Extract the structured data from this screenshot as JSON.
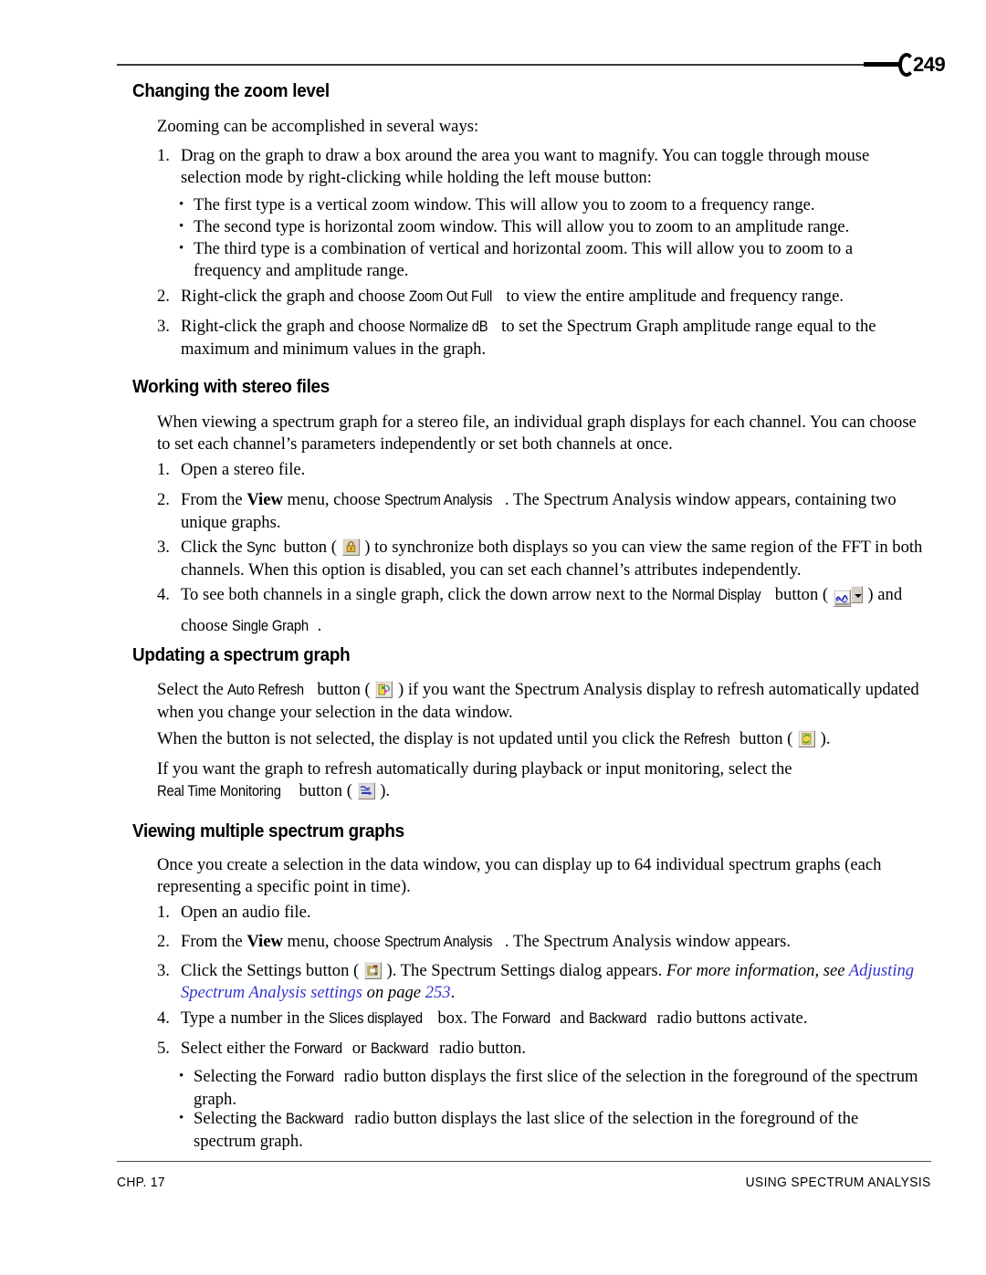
{
  "header": {
    "page_number": "249"
  },
  "footer": {
    "left": "CHP. 17",
    "right": "USING SPECTRUM ANALYSIS"
  },
  "sections": {
    "zoom_level": {
      "heading": "Changing the zoom level",
      "intro": "Zooming can be accomplished in several ways:",
      "item1": {
        "marker": "1.",
        "text": "Drag on the graph to draw a box around the area you want to magnify. You can toggle through mouse selection mode by right-clicking while holding the left mouse button:"
      },
      "bullets": [
        {
          "marker": "•",
          "text": "The first type is a vertical zoom window. This will allow you to zoom to a frequency range."
        },
        {
          "marker": "•",
          "text": "The second type is horizontal zoom window. This will allow you to zoom to an amplitude range."
        },
        {
          "marker": "•",
          "text": "The third type is a combination of vertical and horizontal zoom. This will allow you to zoom to a frequency and amplitude range."
        }
      ],
      "item2": {
        "marker": "2.",
        "pre": "Right-click the graph and choose ",
        "ui": "Zoom Out Full",
        "post": " to view the entire amplitude and frequency range."
      },
      "item3": {
        "marker": "3.",
        "pre": "Right-click the graph and choose ",
        "ui": "Normalize dB",
        "post": " to set the Spectrum Graph amplitude range equal to the maximum and minimum values in the graph."
      }
    },
    "stereo_files": {
      "heading": "Working with stereo files",
      "intro": "When viewing a spectrum graph for a stereo file, an individual graph displays for each channel. You can choose to set each channel’s parameters independently or set both channels at once.",
      "item1": {
        "marker": "1.",
        "text": "Open a stereo file."
      },
      "item2": {
        "marker": "2.",
        "pre": "From the ",
        "menu": "View",
        "mid": " menu, choose ",
        "ui": "Spectrum Analysis",
        "post": ". The Spectrum Analysis window appears, containing two unique graphs."
      },
      "item3": {
        "marker": "3.",
        "pre": "Click the ",
        "ui": "Sync",
        "mid": " button ( ",
        "icon": "lock-icon",
        "post": " ) to synchronize both displays so you can view the same region of the FFT in both channels. When this option is disabled, you can set each channel’s attributes independently."
      },
      "item4": {
        "marker": "4.",
        "pre": "To see both channels in a single graph, click the down arrow next to the ",
        "ui": "Normal Display",
        "mid": " button ( ",
        "icon": "waveform-dropdown-icon",
        "post": " ) and choose ",
        "ui2": "Single Graph",
        "end": "."
      }
    },
    "updating_graph": {
      "heading": "Updating a spectrum graph",
      "para1": {
        "pre": "Select the ",
        "ui": "Auto Refresh",
        "mid": " button ( ",
        "icon": "auto-refresh-icon",
        "post": " ) if you want the Spectrum Analysis display to refresh automatically updated when you change your selection in the data window."
      },
      "para2": {
        "pre": "When the button is not selected, the display is not updated until you click the ",
        "ui": "Refresh",
        "mid": " button ( ",
        "icon": "refresh-icon",
        "post": " )."
      },
      "para3": {
        "pre": "If you want the graph to refresh automatically during playback or input monitoring, select the ",
        "ui": "Real Time Monitoring",
        "mid": " button ( ",
        "icon": "real-time-monitoring-icon",
        "post": " )."
      }
    },
    "multiple_graphs": {
      "heading": "Viewing multiple spectrum graphs",
      "intro": "Once you create a selection in the data window, you can display up to 64 individual spectrum graphs (each representing a specific point in time).",
      "item1": {
        "marker": "1.",
        "text": "Open an audio file."
      },
      "item2": {
        "marker": "2.",
        "pre": "From the ",
        "menu": "View",
        "mid": " menu, choose ",
        "ui": "Spectrum Analysis",
        "post": ". The Spectrum Analysis window appears."
      },
      "item3": {
        "marker": "3.",
        "pre": "Click the Settings button ( ",
        "icon": "settings-icon",
        "mid": " ). The Spectrum Settings dialog appears. ",
        "italic": "For more information, see ",
        "link": "Adjusting Spectrum Analysis settings",
        "on_page": " on page ",
        "page_ref": "253",
        "end": "."
      },
      "item4": {
        "marker": "4.",
        "pre": "Type a number in the ",
        "ui": "Slices displayed",
        "mid": " box. The ",
        "ui2": "Forward",
        "mid2": " and ",
        "ui3": "Backward",
        "post": " radio buttons activate."
      },
      "item5": {
        "marker": "5.",
        "pre": "Select either the ",
        "ui": "Forward",
        "mid": " or ",
        "ui2": "Backward",
        "post": " radio button."
      },
      "bullets": [
        {
          "marker": "•",
          "pre": "Selecting the ",
          "ui": "Forward",
          "post": " radio button displays the first slice of the selection in the foreground of the spectrum graph."
        },
        {
          "marker": "•",
          "pre": "Selecting the ",
          "ui": "Backward",
          "post": " radio button displays the last slice of the selection in the foreground of the spectrum graph."
        }
      ]
    }
  },
  "colors": {
    "link": "#3333cc",
    "rule": "#3a3a3a",
    "icon_face": "#d4d0c8",
    "lock_gold": "#e8b93c",
    "waveform_blue": "#2b32b2"
  }
}
